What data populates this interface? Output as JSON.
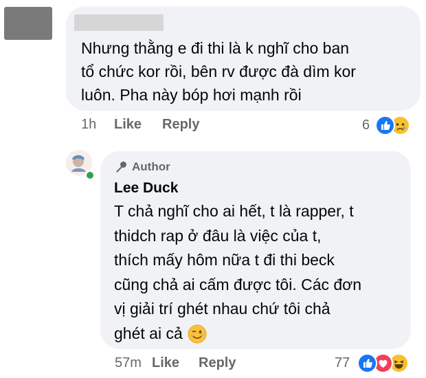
{
  "comment1": {
    "text": "Nhưng thằng e đi thi là k nghĩ cho ban\ntổ chức kor rồi, bên rv được đà dìm kor\nluôn. Pha này bóp hơi mạnh rồi",
    "time": "1h",
    "like_label": "Like",
    "reply_label": "Reply",
    "reaction_count": "6",
    "reactions": [
      "like",
      "sad"
    ]
  },
  "comment2": {
    "badge": "Author",
    "name": "Lee Duck",
    "text": "T chả nghĩ cho ai hết, t là rapper, t\nthidch rap ở đâu là việc của t,\nthích mấy hôm nữa t đi thi beck\ncũng chả ai cấm được tôi. Các đơn\nvị giải trí ghét nhau chứ tôi chả\nghét ai cả",
    "time": "57m",
    "like_label": "Like",
    "reply_label": "Reply",
    "reaction_count": "77",
    "reactions": [
      "like",
      "love",
      "haha"
    ]
  },
  "colors": {
    "bubble": "#f0f2f5",
    "meta_text": "#65676b",
    "like_blue": "#1877f2",
    "love_red": "#f33e58",
    "emoji_yellow": "#f7c12e",
    "online_green": "#31a24c"
  }
}
